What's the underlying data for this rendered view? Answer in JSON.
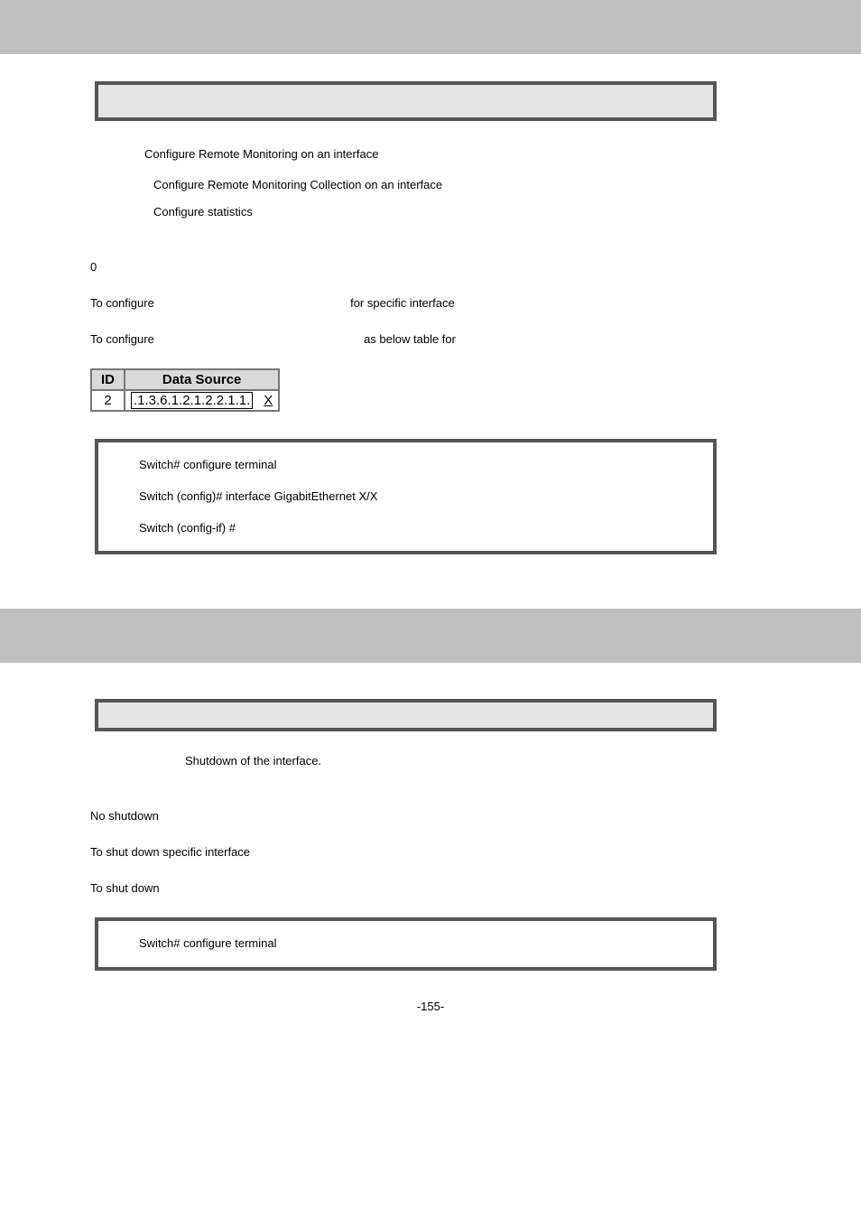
{
  "section1": {
    "options": {
      "l1": "Configure Remote Monitoring on an interface",
      "l2": "Configure Remote Monitoring Collection on an interface",
      "l3": "Configure statistics"
    },
    "default_text": "0",
    "usage_text_a": "To configure",
    "usage_text_b": "for specific interface",
    "example_text_a": "To configure",
    "example_text_b": "as below table for",
    "table": {
      "h1": "ID",
      "h2": "Data Source",
      "r1c1": "2",
      "r1c2": ".1.3.6.1.2.1.2.2.1.1.",
      "r1c3": "X"
    },
    "example_lines": {
      "l1": "Switch# configure terminal",
      "l2": "Switch (config)# interface GigabitEthernet X/X",
      "l3": "Switch (config-if) #"
    }
  },
  "section2": {
    "purpose_text": "Shutdown of the interface.",
    "default_text": "No shutdown",
    "usage_text": "To shut down specific interface",
    "example_intro": "To shut down",
    "example_lines": {
      "l1": "Switch# configure terminal"
    }
  },
  "footer": "-155-"
}
